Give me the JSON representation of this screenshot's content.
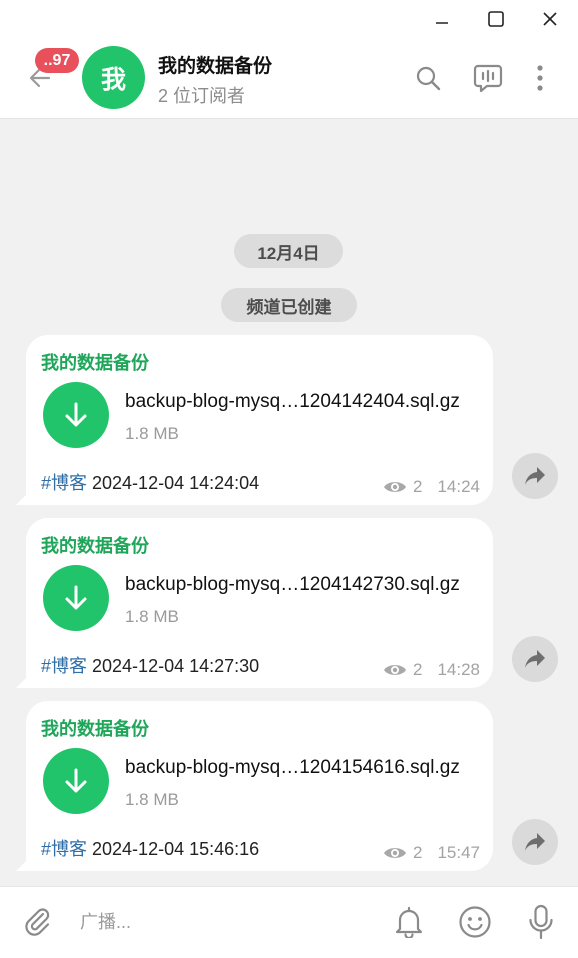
{
  "window": {
    "controls": [
      {
        "name": "minimize",
        "icon": "minimize-icon"
      },
      {
        "name": "maximize",
        "icon": "maximize-icon"
      },
      {
        "name": "close",
        "icon": "close-icon"
      }
    ]
  },
  "header": {
    "unread_badge": "..97",
    "avatar_letter": "我",
    "title": "我的数据备份",
    "subtitle": "2 位订阅者",
    "icons": [
      "back-arrow-icon",
      "search-icon",
      "voice-chat-icon",
      "more-vertical-icon"
    ]
  },
  "chat": {
    "date_pill": "12月4日",
    "service_message": "频道已创建",
    "messages": [
      {
        "sender": "我的数据备份",
        "file_name": "backup-blog-mysq…1204142404.sql.gz",
        "file_size": "1.8 MB",
        "caption_tag": "#博客",
        "caption_text": " 2024-12-04 14:24:04",
        "views": "2",
        "time": "14:24"
      },
      {
        "sender": "我的数据备份",
        "file_name": "backup-blog-mysq…1204142730.sql.gz",
        "file_size": "1.8 MB",
        "caption_tag": "#博客",
        "caption_text": " 2024-12-04 14:27:30",
        "views": "2",
        "time": "14:28"
      },
      {
        "sender": "我的数据备份",
        "file_name": "backup-blog-mysq…1204154616.sql.gz",
        "file_size": "1.8 MB",
        "caption_tag": "#博客",
        "caption_text": " 2024-12-04 15:46:16",
        "views": "2",
        "time": "15:47"
      }
    ]
  },
  "composer": {
    "placeholder": "广播...",
    "icons": [
      "attach-icon",
      "notification-bell-icon",
      "emoji-icon",
      "microphone-icon"
    ]
  },
  "colors": {
    "accent": "#22c46b",
    "sender_name": "#1fa65a",
    "hashtag": "#2f6ea7",
    "badge": "#e8505b",
    "chat_background": "#f1f1f1"
  }
}
